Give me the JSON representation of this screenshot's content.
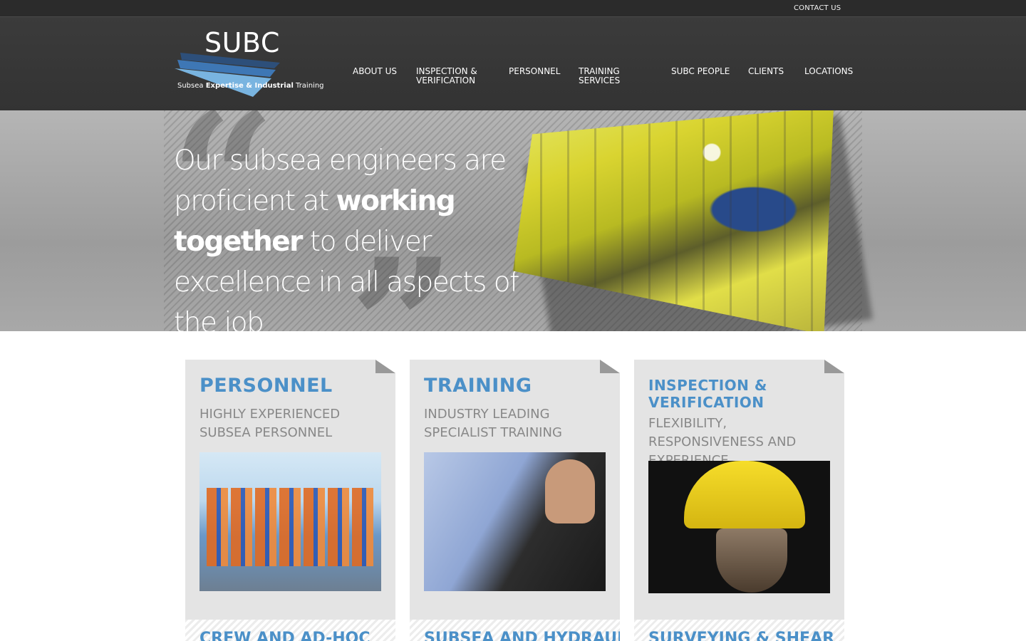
{
  "topbar": {
    "contact_label": "CONTACT US"
  },
  "logo": {
    "name": "SUBC",
    "tagline_part1": "Subsea ",
    "tagline_bold": "Expertise & Industrial",
    "tagline_part2": " Training"
  },
  "nav": {
    "items": [
      {
        "label": "ABOUT US"
      },
      {
        "label": "INSPECTION & VERIFICATION"
      },
      {
        "label": "PERSONNEL"
      },
      {
        "label": "TRAINING SERVICES"
      },
      {
        "label": "SUBC PEOPLE"
      },
      {
        "label": "CLIENTS"
      },
      {
        "label": "LOCATIONS"
      }
    ]
  },
  "hero": {
    "quote_part1": "Our subsea engineers are proficient at ",
    "quote_bold": "working together",
    "quote_part2": " to deliver excellence in all aspects of the job"
  },
  "cards": [
    {
      "title": "PERSONNEL",
      "subtitle": "HIGHLY EXPERIENCED SUBSEA PERSONNEL"
    },
    {
      "title": "TRAINING",
      "subtitle": "INDUSTRY LEADING SPECIALIST TRAINING"
    },
    {
      "title": "INSPECTION & VERIFICATION",
      "subtitle": "FLEXIBILITY, RESPONSIVENESS AND EXPERIENCE"
    }
  ],
  "cards_row2": [
    {
      "title": "CREW AND AD-HOC"
    },
    {
      "title": "SUBSEA AND HYDRAULIC"
    },
    {
      "title": "SURVEYING & SHEAR"
    }
  ],
  "colors": {
    "accent": "#4b90c8",
    "header_bg": "#363636",
    "card_bg": "#e4e4e4"
  }
}
